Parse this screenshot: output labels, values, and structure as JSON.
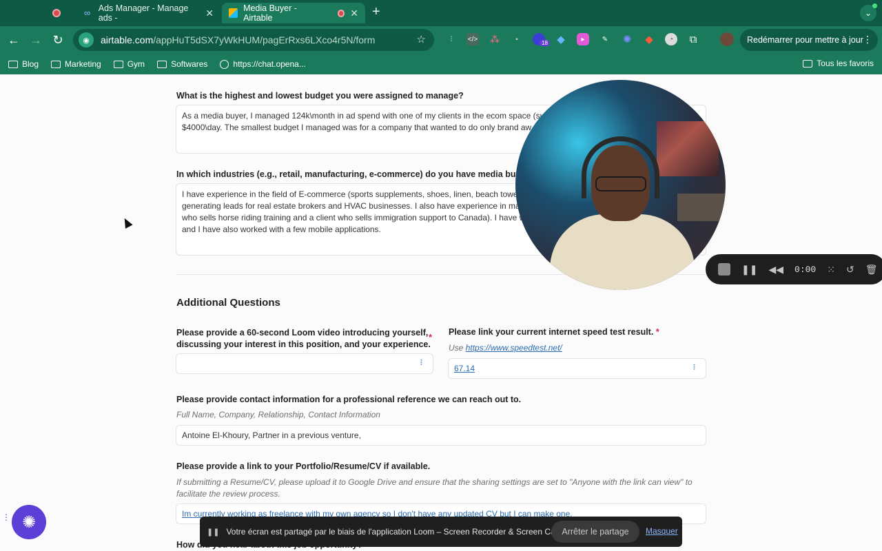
{
  "browser": {
    "tabs": [
      {
        "title": "Ads Manager - Manage ads -",
        "active": false
      },
      {
        "title": "Media Buyer - Airtable",
        "active": true
      }
    ],
    "url_host": "airtable.com",
    "url_path": "/appHuT5dSX7yWkHUM/pagErRxs6LXco4r5N/form",
    "restart_label": "Redémarrer pour mettre à jour",
    "extension_badge": "18",
    "bookmarks": [
      "Blog",
      "Marketing",
      "Gym",
      "Softwares",
      "https://chat.opena..."
    ],
    "all_bookmarks": "Tous les favoris"
  },
  "form": {
    "q_budget": "What is the highest and lowest budget you were assigned to manage?",
    "a_budget_1": "As a media buyer, I managed 124k\\month in ad spend with one of my clients in the ecom space (su",
    "a_budget_2": "$4000\\day. The smallest budget I managed was for a company that wanted to do only brand aw",
    "q_industries": "In which industries (e.g., retail, manufacturing, e-commerce) do you have media buying ex",
    "a_industries_1": "I have experience in the field of E-commerce (sports supplements, shoes, linen, beach towe",
    "a_industries_2": "generating leads for real estate brokers and HVAC businesses. I also have experience in mar",
    "a_industries_3": "who sells horse riding training and a client who sells immigration support to Canada). I have w",
    "a_industries_4": "and I have also worked with a few mobile applications.",
    "section_title": "Additional Questions",
    "q_loom_1": "Please provide a 60-second Loom video introducing yourself,",
    "q_loom_2": "discussing your interest in this position, and your experience.",
    "q_speed": "Please link your current internet speed test result.",
    "hint_speed_prefix": "Use",
    "hint_speed_link": "https://www.speedtest.net/",
    "a_speed": "67.14",
    "q_reference": "Please provide contact information for a professional reference we can reach out to.",
    "hint_reference": "Full Name, Company, Relationship, Contact Information",
    "a_reference": "Antoine El-Khoury, Partner in a previous venture,",
    "q_portfolio": "Please provide a link to your Portfolio/Resume/CV if available.",
    "hint_portfolio_1": "If submitting a Resume/CV, please upload it to Google Drive and ensure that the sharing settings are set to \"Anyone with the link can view\" to",
    "hint_portfolio_2": "facilitate the review process.",
    "a_portfolio": "Im currently working as freelance with my own agency so I don't have any updated CV but I can make one.",
    "q_hear": "How did you hear about this job opportunity?",
    "required_mark": "*"
  },
  "recorder": {
    "time": "0:00"
  },
  "share_banner": {
    "message": "Votre écran est partagé par le biais de l'application Loom – Screen Recorder & Screen Capture.",
    "stop_label": "Arrêter le partage",
    "hide_label": "Masquer"
  },
  "colors": {
    "chrome_dark": "#0f5a44",
    "chrome": "#1c7a5c",
    "accent": "#5b3fd6",
    "required": "#d1284b",
    "link": "#2b6cb0"
  },
  "icons": [
    "record-icon",
    "meta-icon",
    "airtable-icon",
    "back-icon",
    "forward-icon",
    "reload-icon",
    "star-icon",
    "folder-icon",
    "stop-icon",
    "pause-icon",
    "rewind-icon",
    "restart-icon",
    "trash-icon",
    "grid-icon"
  ]
}
